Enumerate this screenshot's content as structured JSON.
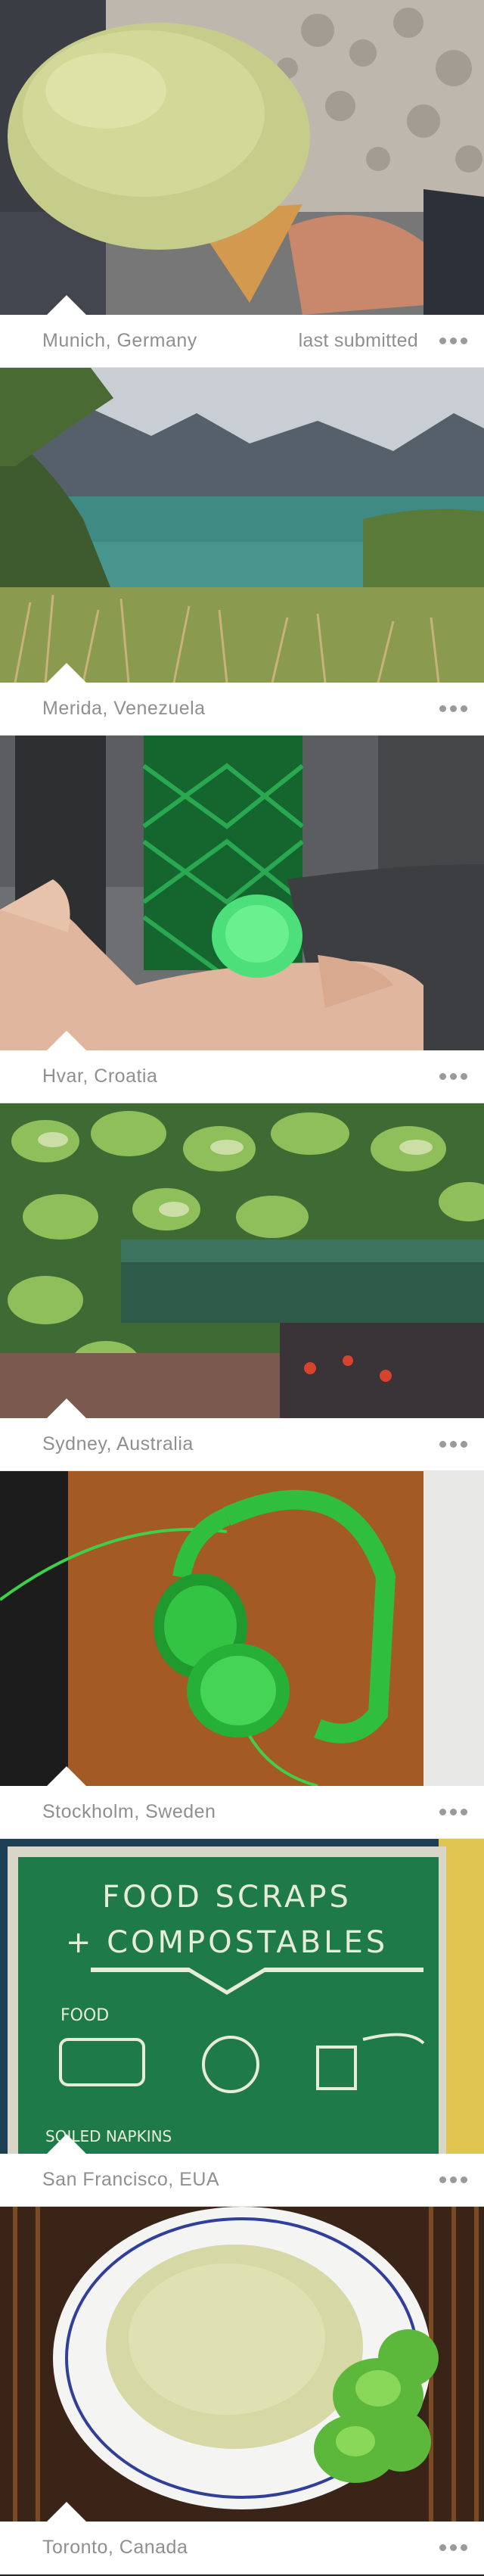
{
  "cards": [
    {
      "location": "Munich, Germany",
      "meta": "last submitted",
      "more_icon": "more-dots-icon",
      "photo": "pistachio gelato cone over cobblestone"
    },
    {
      "location": "Merida, Venezuela",
      "meta": "",
      "more_icon": "more-dots-icon",
      "photo": "mountain lake"
    },
    {
      "location": "Hvar, Croatia",
      "meta": "",
      "more_icon": "more-dots-icon",
      "photo": "hand with green knitted ring"
    },
    {
      "location": "Sydney, Australia",
      "meta": "",
      "more_icon": "more-dots-icon",
      "photo": "ivy leaves and green bench"
    },
    {
      "location": "Stockholm, Sweden",
      "meta": "",
      "more_icon": "more-dots-icon",
      "photo": "green headphones"
    },
    {
      "location": "San Francisco, EUA",
      "meta": "",
      "more_icon": "more-dots-icon",
      "photo": "compost sign"
    },
    {
      "location": "Toronto, Canada",
      "meta": "",
      "more_icon": "more-dots-icon",
      "photo": "bowl of soup with lettuce"
    }
  ],
  "sign": {
    "line1": "FOOD SCRAPS",
    "line2": "+ COMPOSTABLES",
    "label1": "FOOD",
    "label2": "SOILED NAPKINS"
  },
  "colors": {
    "caption_bg": "#ffffff",
    "caption_text": "#8f8f8f",
    "dots": "#9a9a9a",
    "sign_green": "#1f7a4a"
  }
}
